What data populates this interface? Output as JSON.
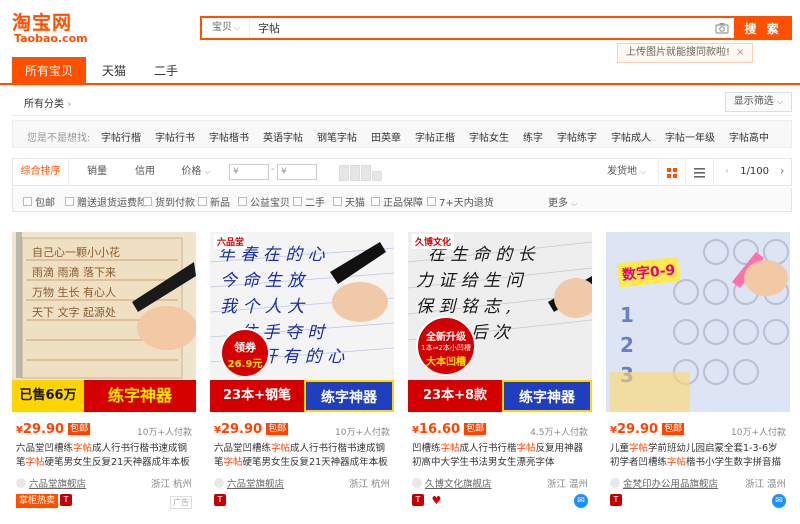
{
  "header": {
    "logo_cn": "淘宝网",
    "logo_en": "Taobao.com",
    "search_type": "宝贝",
    "search_value": "字帖",
    "search_button": "搜 索",
    "tip": "上传图片就能搜同款啦!",
    "tip_close": "×"
  },
  "tabs": [
    "所有宝贝",
    "天猫",
    "二手"
  ],
  "category": {
    "label": "所有分类",
    "filter_button": "显示筛选"
  },
  "suggest": {
    "label": "您是不是想找:",
    "items": [
      "字帖行楷",
      "字帖行书",
      "字帖楷书",
      "英语字帖",
      "钢笔字帖",
      "田英章",
      "字帖正楷",
      "字帖女生",
      "练字",
      "字帖练字",
      "字帖成人",
      "字帖一年级",
      "字帖高中"
    ]
  },
  "sortbar": {
    "items": [
      "综合排序",
      "销量",
      "信用",
      "价格"
    ],
    "price_min_placeholder": "¥",
    "price_sep": "-",
    "price_max_placeholder": "¥",
    "ship_from": "发货地",
    "pager": "1/100"
  },
  "checkboxes": [
    "包邮",
    "赠送退货运费险",
    "货到付款",
    "新品",
    "公益宝贝",
    "二手",
    "天猫",
    "正品保障",
    "7+天内退货"
  ],
  "more_label": "更多",
  "products": [
    {
      "banner_left": "已售66万",
      "banner_right": "练字神器",
      "price": "29.90",
      "baoyou": "包邮",
      "paid": "10万+人付款",
      "title_pre": "六品堂凹槽练",
      "title_hl1": "字帖",
      "title_mid": "成人行书行楷书速成钢笔",
      "title_hl2": "字帖",
      "title_post": "硬笔男女生反复21天神器成年本板字体",
      "shop": "六品堂旗舰店",
      "location": "浙江 杭州",
      "badge": "掌柜热卖",
      "ad": "广告"
    },
    {
      "banner_left": "23本+钢笔",
      "banner_right": "练字神器",
      "stamp_top": "领券",
      "stamp_bottom": "26.9元",
      "brand": "六品堂",
      "price": "29.90",
      "baoyou": "包邮",
      "paid": "10万+人付款",
      "title_pre": "六品堂凹槽练",
      "title_hl1": "字帖",
      "title_mid": "成人行书行楷书速成钢笔",
      "title_hl2": "字帖",
      "title_post": "硬笔男女生反复21天神器成年本板字体",
      "shop": "六品堂旗舰店",
      "location": "浙江 杭州"
    },
    {
      "banner_left": "23本+8款",
      "banner_right": "练字神器",
      "stamp_top": "全新升级",
      "stamp_mid": "1本⇒2本小凹槽",
      "stamp_bottom": "大本凹槽",
      "brand": "久博文化",
      "price": "16.60",
      "baoyou": "包邮",
      "paid": "4.5万+人付款",
      "title_pre": "凹槽练",
      "title_hl1": "字帖",
      "title_mid": "成人行书行楷",
      "title_hl2": "字帖",
      "title_post": "反复用神器初高中大学生书法男女生漂亮字体",
      "shop": "久博文化旗舰店",
      "location": "浙江 温州"
    },
    {
      "price": "29.90",
      "baoyou": "包邮",
      "paid": "10万+人付款",
      "label_num": "数字0-9",
      "title_pre": "儿童",
      "title_hl1": "字帖",
      "title_mid": "学前班幼儿园启蒙全套1-3-6岁初学者凹槽练",
      "title_hl2": "字帖",
      "title_post": "楷书小学生数字拼音描红练",
      "shop": "金梵印办公用品旗舰店",
      "location": "浙江 温州"
    }
  ],
  "colors": {
    "accent": "#ff5000",
    "price": "#ff4400",
    "banner_yellow": "#ffd400",
    "banner_red": "#d40000",
    "banner_blue": "#1f3fbf"
  }
}
